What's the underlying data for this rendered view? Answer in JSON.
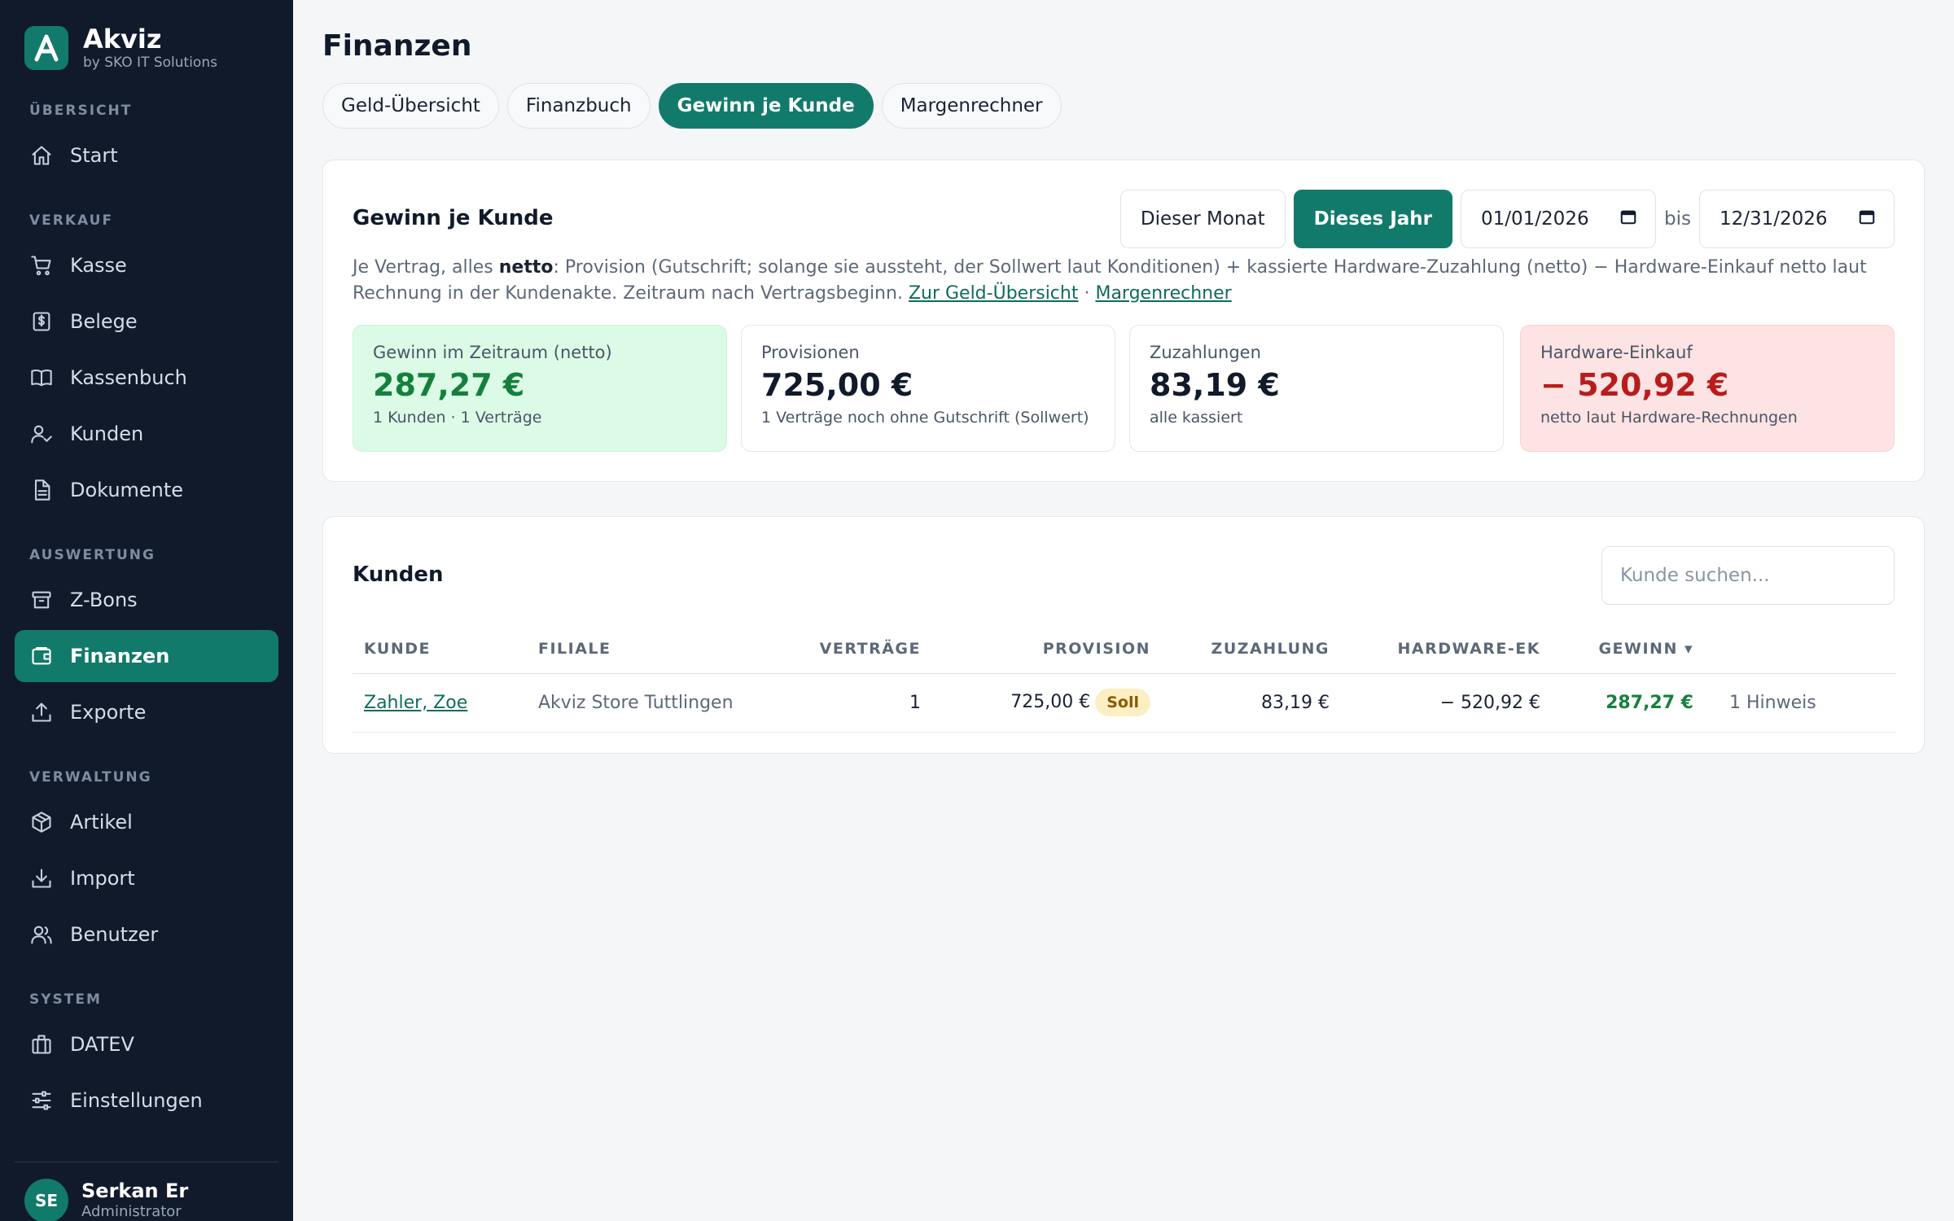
{
  "brand": {
    "name": "Akviz",
    "sub": "by SKO IT Solutions",
    "logo_letter": "A",
    "color": "#127a6b"
  },
  "nav": {
    "sections": [
      {
        "title": "ÜBERSICHT",
        "items": [
          {
            "label": "Start",
            "icon": "home-icon"
          }
        ]
      },
      {
        "title": "VERKAUF",
        "items": [
          {
            "label": "Kasse",
            "icon": "cart-icon"
          },
          {
            "label": "Belege",
            "icon": "receipt-icon"
          },
          {
            "label": "Kassenbuch",
            "icon": "book-icon"
          },
          {
            "label": "Kunden",
            "icon": "user-check-icon"
          },
          {
            "label": "Dokumente",
            "icon": "document-icon"
          }
        ]
      },
      {
        "title": "AUSWERTUNG",
        "items": [
          {
            "label": "Z-Bons",
            "icon": "archive-icon"
          },
          {
            "label": "Finanzen",
            "icon": "wallet-icon",
            "active": true
          },
          {
            "label": "Exporte",
            "icon": "upload-icon"
          }
        ]
      },
      {
        "title": "VERWALTUNG",
        "items": [
          {
            "label": "Artikel",
            "icon": "package-icon"
          },
          {
            "label": "Import",
            "icon": "download-icon"
          },
          {
            "label": "Benutzer",
            "icon": "users-icon"
          }
        ]
      },
      {
        "title": "SYSTEM",
        "items": [
          {
            "label": "DATEV",
            "icon": "building-icon"
          },
          {
            "label": "Einstellungen",
            "icon": "sliders-icon"
          }
        ]
      }
    ]
  },
  "user": {
    "initials": "SE",
    "name": "Serkan Er",
    "role": "Administrator"
  },
  "page": {
    "title": "Finanzen"
  },
  "tabs": [
    {
      "label": "Geld-Übersicht"
    },
    {
      "label": "Finanzbuch"
    },
    {
      "label": "Gewinn je Kunde",
      "active": true
    },
    {
      "label": "Margenrechner"
    }
  ],
  "profit": {
    "title": "Gewinn je Kunde",
    "filter_month": "Dieser Monat",
    "filter_year": "Dieses Jahr",
    "date_from": "01/01/2026",
    "bis": "bis",
    "date_to": "12/31/2026",
    "desc": {
      "p1": "Je Vertrag, alles ",
      "bold": "netto",
      "p2": ": Provision (Gutschrift; solange sie aussteht, der Sollwert laut Konditionen) + kassierte Hardware-Zuzahlung (netto) − Hardware-Einkauf netto laut Rechnung in der Kundenakte. Zeitraum nach Vertragsbeginn. ",
      "link1": "Zur Geld-Übersicht",
      "sep": " · ",
      "link2": "Margenrechner"
    },
    "stats": [
      {
        "label": "Gewinn im Zeitraum (netto)",
        "value": "287,27 €",
        "sub": "1 Kunden · 1 Verträge",
        "tone": "green"
      },
      {
        "label": "Provisionen",
        "value": "725,00 €",
        "sub": "1 Verträge noch ohne Gutschrift (Sollwert)",
        "tone": "neutral"
      },
      {
        "label": "Zuzahlungen",
        "value": "83,19 €",
        "sub": "alle kassiert",
        "tone": "neutral"
      },
      {
        "label": "Hardware-Einkauf",
        "value": "− 520,92 €",
        "sub": "netto laut Hardware-Rechnungen",
        "tone": "red"
      }
    ]
  },
  "customers": {
    "title": "Kunden",
    "search_placeholder": "Kunde suchen...",
    "columns": [
      "KUNDE",
      "FILIALE",
      "VERTRÄGE",
      "PROVISION",
      "ZUZAHLUNG",
      "HARDWARE-EK",
      "GEWINN ▾",
      ""
    ],
    "rows": [
      {
        "kunde": "Zahler, Zoe",
        "filiale": "Akviz Store Tuttlingen",
        "vertraege": "1",
        "provision": "725,00 €",
        "badge": "Soll",
        "zuzahlung": "83,19 €",
        "hardware": "− 520,92 €",
        "gewinn": "287,27 €",
        "hinweis": "1 Hinweis"
      }
    ]
  }
}
